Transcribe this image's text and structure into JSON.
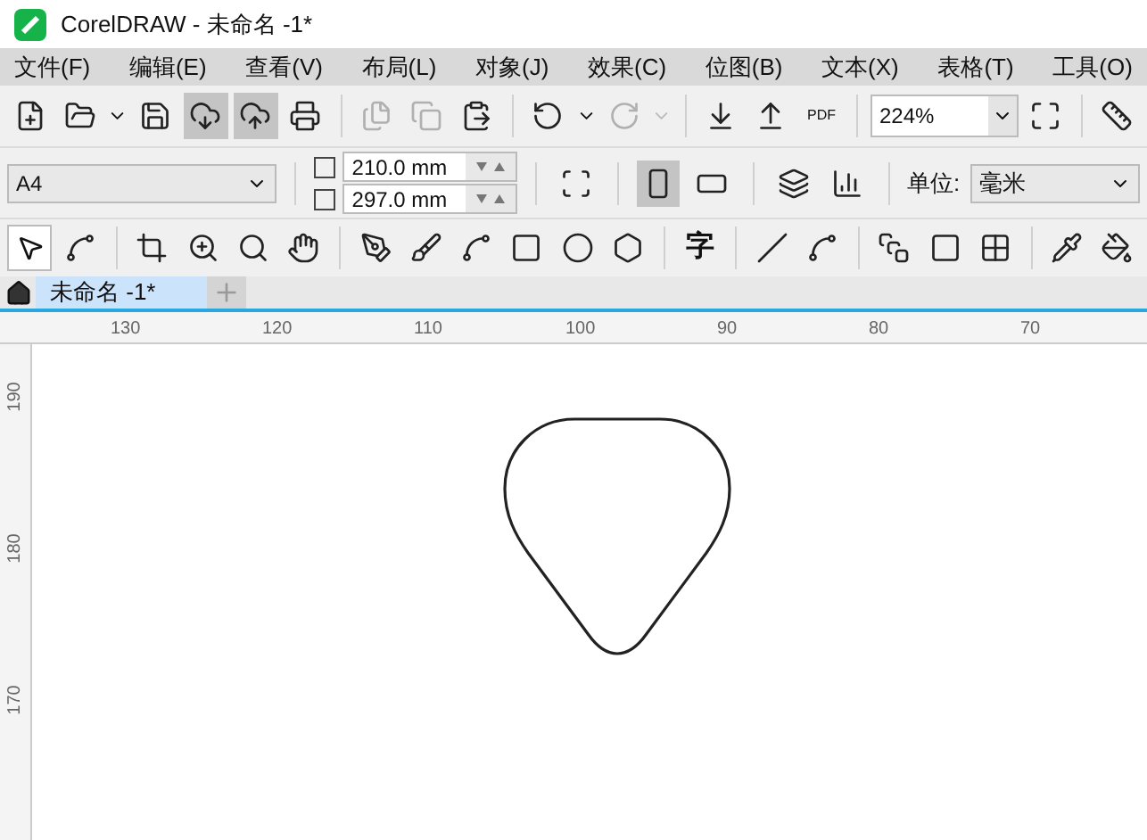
{
  "window": {
    "title": "CorelDRAW - 未命名 -1*"
  },
  "menu": [
    "文件(F)",
    "编辑(E)",
    "查看(V)",
    "布局(L)",
    "对象(J)",
    "效果(C)",
    "位图(B)",
    "文本(X)",
    "表格(T)",
    "工具(O)"
  ],
  "toolbar": {
    "pdf_label": "PDF",
    "zoom": "224%"
  },
  "property_bar": {
    "page_size": "A4",
    "width": "210.0 mm",
    "height": "297.0 mm",
    "unit_label": "单位:",
    "unit": "毫米"
  },
  "toolbox": {
    "text_tool_glyph": "字"
  },
  "tabs": [
    {
      "label": "未命名 -1*",
      "selected": true
    }
  ],
  "ruler": {
    "horizontal": [
      "130",
      "120",
      "110",
      "100",
      "90",
      "80",
      "70"
    ],
    "vertical": [
      "190",
      "180",
      "170"
    ]
  }
}
